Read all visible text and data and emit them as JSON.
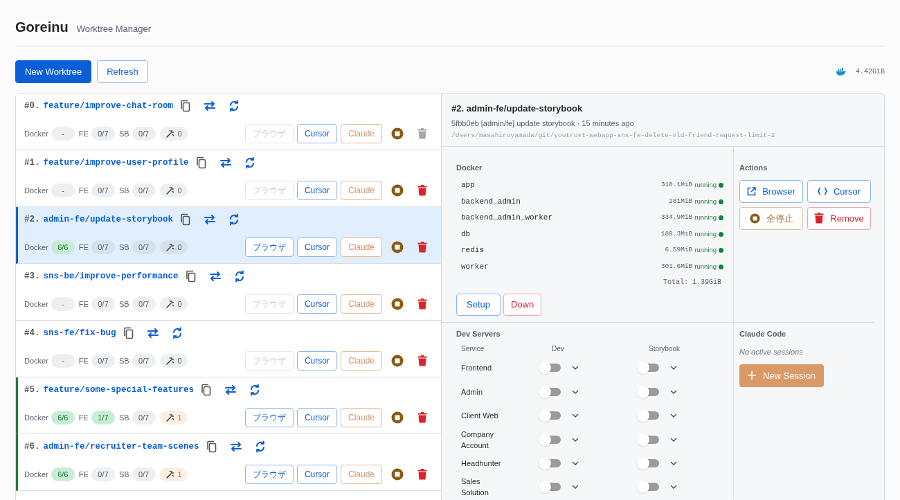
{
  "app": {
    "title": "Goreinu",
    "subtitle": "Worktree Manager"
  },
  "toolbar": {
    "buttons": [
      {
        "label": "New Worktree",
        "kind": "primary"
      },
      {
        "label": "Refresh",
        "kind": "outline"
      }
    ],
    "docker_usage": "4.42GiB"
  },
  "worktrees": [
    {
      "index": "#0.",
      "branch": "feature/improve-chat-room",
      "selected": false,
      "docker": {
        "label": "Docker",
        "value": "-",
        "active": false
      },
      "fe": {
        "label": "FE",
        "value": "0/7",
        "active": false
      },
      "sb": {
        "label": "SB",
        "value": "0/7",
        "active": false
      },
      "claude_count": {
        "value": "0",
        "active": false
      },
      "buttons": {
        "browser": "ブラウザ",
        "browser_disabled": true,
        "cursor": "Cursor",
        "claude": "Claude"
      },
      "delete_disabled": true
    },
    {
      "index": "#1.",
      "branch": "feature/improve-user-profile",
      "selected": false,
      "docker": {
        "label": "Docker",
        "value": "-",
        "active": false
      },
      "fe": {
        "label": "FE",
        "value": "0/7",
        "active": false
      },
      "sb": {
        "label": "SB",
        "value": "0/7",
        "active": false
      },
      "claude_count": {
        "value": "0",
        "active": false
      },
      "buttons": {
        "browser": "ブラウザ",
        "browser_disabled": true,
        "cursor": "Cursor",
        "claude": "Claude"
      },
      "delete_disabled": false
    },
    {
      "index": "#2.",
      "branch": "admin-fe/update-storybook",
      "selected": true,
      "docker": {
        "label": "Docker",
        "value": "6/6",
        "active": true
      },
      "fe": {
        "label": "FE",
        "value": "0/7",
        "active": false
      },
      "sb": {
        "label": "SB",
        "value": "0/7",
        "active": false
      },
      "claude_count": {
        "value": "0",
        "active": false
      },
      "buttons": {
        "browser": "ブラウザ",
        "browser_disabled": false,
        "cursor": "Cursor",
        "claude": "Claude"
      },
      "delete_disabled": false
    },
    {
      "index": "#3.",
      "branch": "sns-be/improve-performance",
      "selected": false,
      "docker": {
        "label": "Docker",
        "value": "-",
        "active": false
      },
      "fe": {
        "label": "FE",
        "value": "0/7",
        "active": false
      },
      "sb": {
        "label": "SB",
        "value": "0/7",
        "active": false
      },
      "claude_count": {
        "value": "0",
        "active": false
      },
      "buttons": {
        "browser": "ブラウザ",
        "browser_disabled": true,
        "cursor": "Cursor",
        "claude": "Claude"
      },
      "delete_disabled": false
    },
    {
      "index": "#4.",
      "branch": "sns-fe/fix-bug",
      "selected": false,
      "docker": {
        "label": "Docker",
        "value": "-",
        "active": false
      },
      "fe": {
        "label": "FE",
        "value": "0/7",
        "active": false
      },
      "sb": {
        "label": "SB",
        "value": "0/7",
        "active": false
      },
      "claude_count": {
        "value": "0",
        "active": false
      },
      "buttons": {
        "browser": "ブラウザ",
        "browser_disabled": true,
        "cursor": "Cursor",
        "claude": "Claude"
      },
      "delete_disabled": false
    },
    {
      "index": "#5.",
      "branch": "feature/some-special-features",
      "selected": false,
      "docker": {
        "label": "Docker",
        "value": "6/6",
        "active": true
      },
      "fe": {
        "label": "FE",
        "value": "1/7",
        "active": true
      },
      "sb": {
        "label": "SB",
        "value": "0/7",
        "active": false
      },
      "claude_count": {
        "value": "1",
        "active": true
      },
      "buttons": {
        "browser": "ブラウザ",
        "browser_disabled": false,
        "cursor": "Cursor",
        "claude": "Claude"
      },
      "delete_disabled": false
    },
    {
      "index": "#6.",
      "branch": "admin-fe/recruiter-team-scenes",
      "selected": false,
      "docker": {
        "label": "Docker",
        "value": "6/6",
        "active": true
      },
      "fe": {
        "label": "FE",
        "value": "0/7",
        "active": false
      },
      "sb": {
        "label": "SB",
        "value": "0/7",
        "active": false
      },
      "claude_count": {
        "value": "1",
        "active": true
      },
      "buttons": {
        "browser": "ブラウザ",
        "browser_disabled": false,
        "cursor": "Cursor",
        "claude": "Claude"
      },
      "delete_disabled": false
    }
  ],
  "detail": {
    "title": "#2. admin-fe/update-storybook",
    "commit": "5fbb0eb [admin/fe] update storybook · 15 minutes ago",
    "path": "/Users/masahiroyamada/git/youtrust-webapp-sns-fe-delete-old-friend-request-limit-2",
    "docker": {
      "heading": "Docker",
      "containers": [
        {
          "name": "app",
          "memory": "310.1MiB",
          "status": "running",
          "color": "#15803d"
        },
        {
          "name": "backend_admin",
          "memory": "281MiB",
          "status": "running",
          "color": "#15803d"
        },
        {
          "name": "backend_admin_worker",
          "memory": "334.9MiB",
          "status": "running",
          "color": "#15803d"
        },
        {
          "name": "db",
          "memory": "189.3MiB",
          "status": "running",
          "color": "#15803d"
        },
        {
          "name": "redis",
          "memory": "6.59MiB",
          "status": "running",
          "color": "#15803d"
        },
        {
          "name": "worker",
          "memory": "301.6MiB",
          "status": "running",
          "color": "#15803d"
        }
      ],
      "total": "Total: 1.39GiB",
      "buttons": [
        {
          "label": "Setup",
          "kind": "blue"
        },
        {
          "label": "Down",
          "kind": "red"
        }
      ]
    },
    "actions": {
      "heading": "Actions",
      "buttons": [
        {
          "label": "Browser",
          "kind": "browser"
        },
        {
          "label": "Cursor",
          "kind": "cursor"
        },
        {
          "label": "全停止",
          "kind": "stop"
        },
        {
          "label": "Remove",
          "kind": "remove"
        }
      ]
    },
    "dev_servers": {
      "heading": "Dev Servers",
      "columns": [
        "Service",
        "Dev",
        "Storybook"
      ],
      "rows": [
        {
          "service": "Frontend",
          "dev_on": false,
          "storybook_on": false
        },
        {
          "service": "Admin",
          "dev_on": false,
          "storybook_on": false
        },
        {
          "service": "Client Web",
          "dev_on": false,
          "storybook_on": false
        },
        {
          "service": "Company Account",
          "dev_on": false,
          "storybook_on": false
        },
        {
          "service": "Headhunter",
          "dev_on": false,
          "storybook_on": false
        },
        {
          "service": "Sales Solution",
          "dev_on": false,
          "storybook_on": false
        }
      ]
    },
    "claude_code": {
      "heading": "Claude Code",
      "empty_text": "No active sessions",
      "button": "New Session"
    }
  }
}
